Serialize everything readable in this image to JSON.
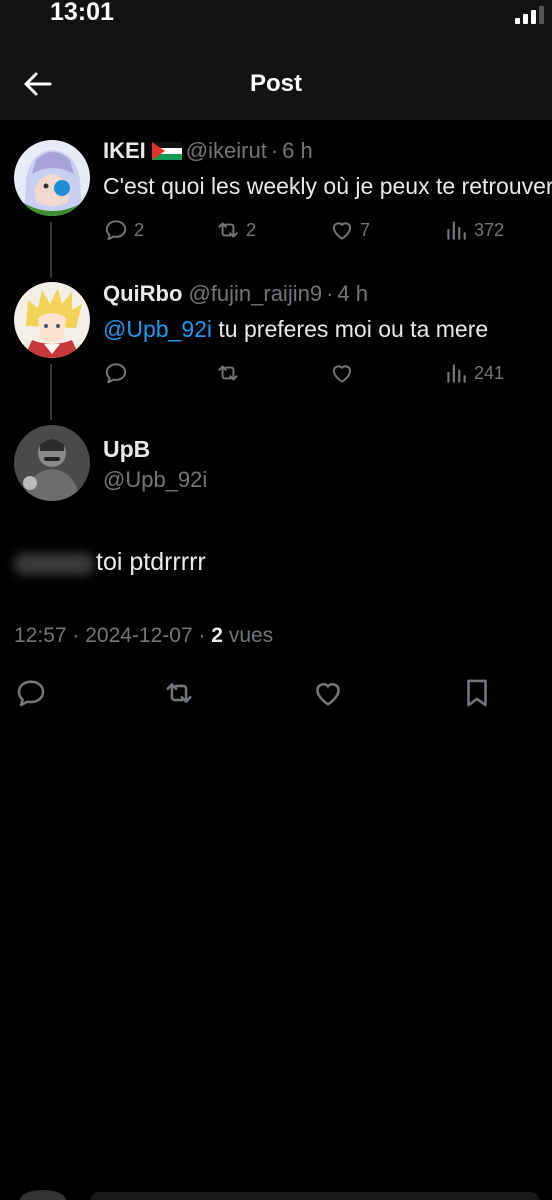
{
  "status_bar": {
    "time": "13:01"
  },
  "header": {
    "title": "Post"
  },
  "thread": [
    {
      "name": "IKEI",
      "handle": "@ikeirut",
      "separator": "·",
      "time": "6 h",
      "text": "C'est quoi les weekly où je peux te retrouver",
      "replies": "2",
      "reposts": "2",
      "likes": "7",
      "views": "372"
    },
    {
      "name": "QuiRbo",
      "handle": "@fujin_raijin9",
      "separator": "·",
      "time": "4 h",
      "mention": "@Upb_92i",
      "text": " tu preferes moi ou ta mere",
      "views": "241"
    }
  ],
  "main_post": {
    "name": "UpB",
    "handle": "@Upb_92i",
    "text": "toi ptdrrrrr",
    "timestamp": "12:57 · 2024-12-07 · ",
    "views_count": "2",
    "views_label": " vues"
  },
  "colors": {
    "accent": "#1d9bf0",
    "muted": "#71767b",
    "text": "#e7e9ea",
    "background": "#000000"
  },
  "icons": [
    "arrow-left-icon",
    "reply-icon",
    "repost-icon",
    "like-icon",
    "views-icon",
    "bookmark-icon",
    "palestine-flag-icon",
    "signal-icon"
  ]
}
